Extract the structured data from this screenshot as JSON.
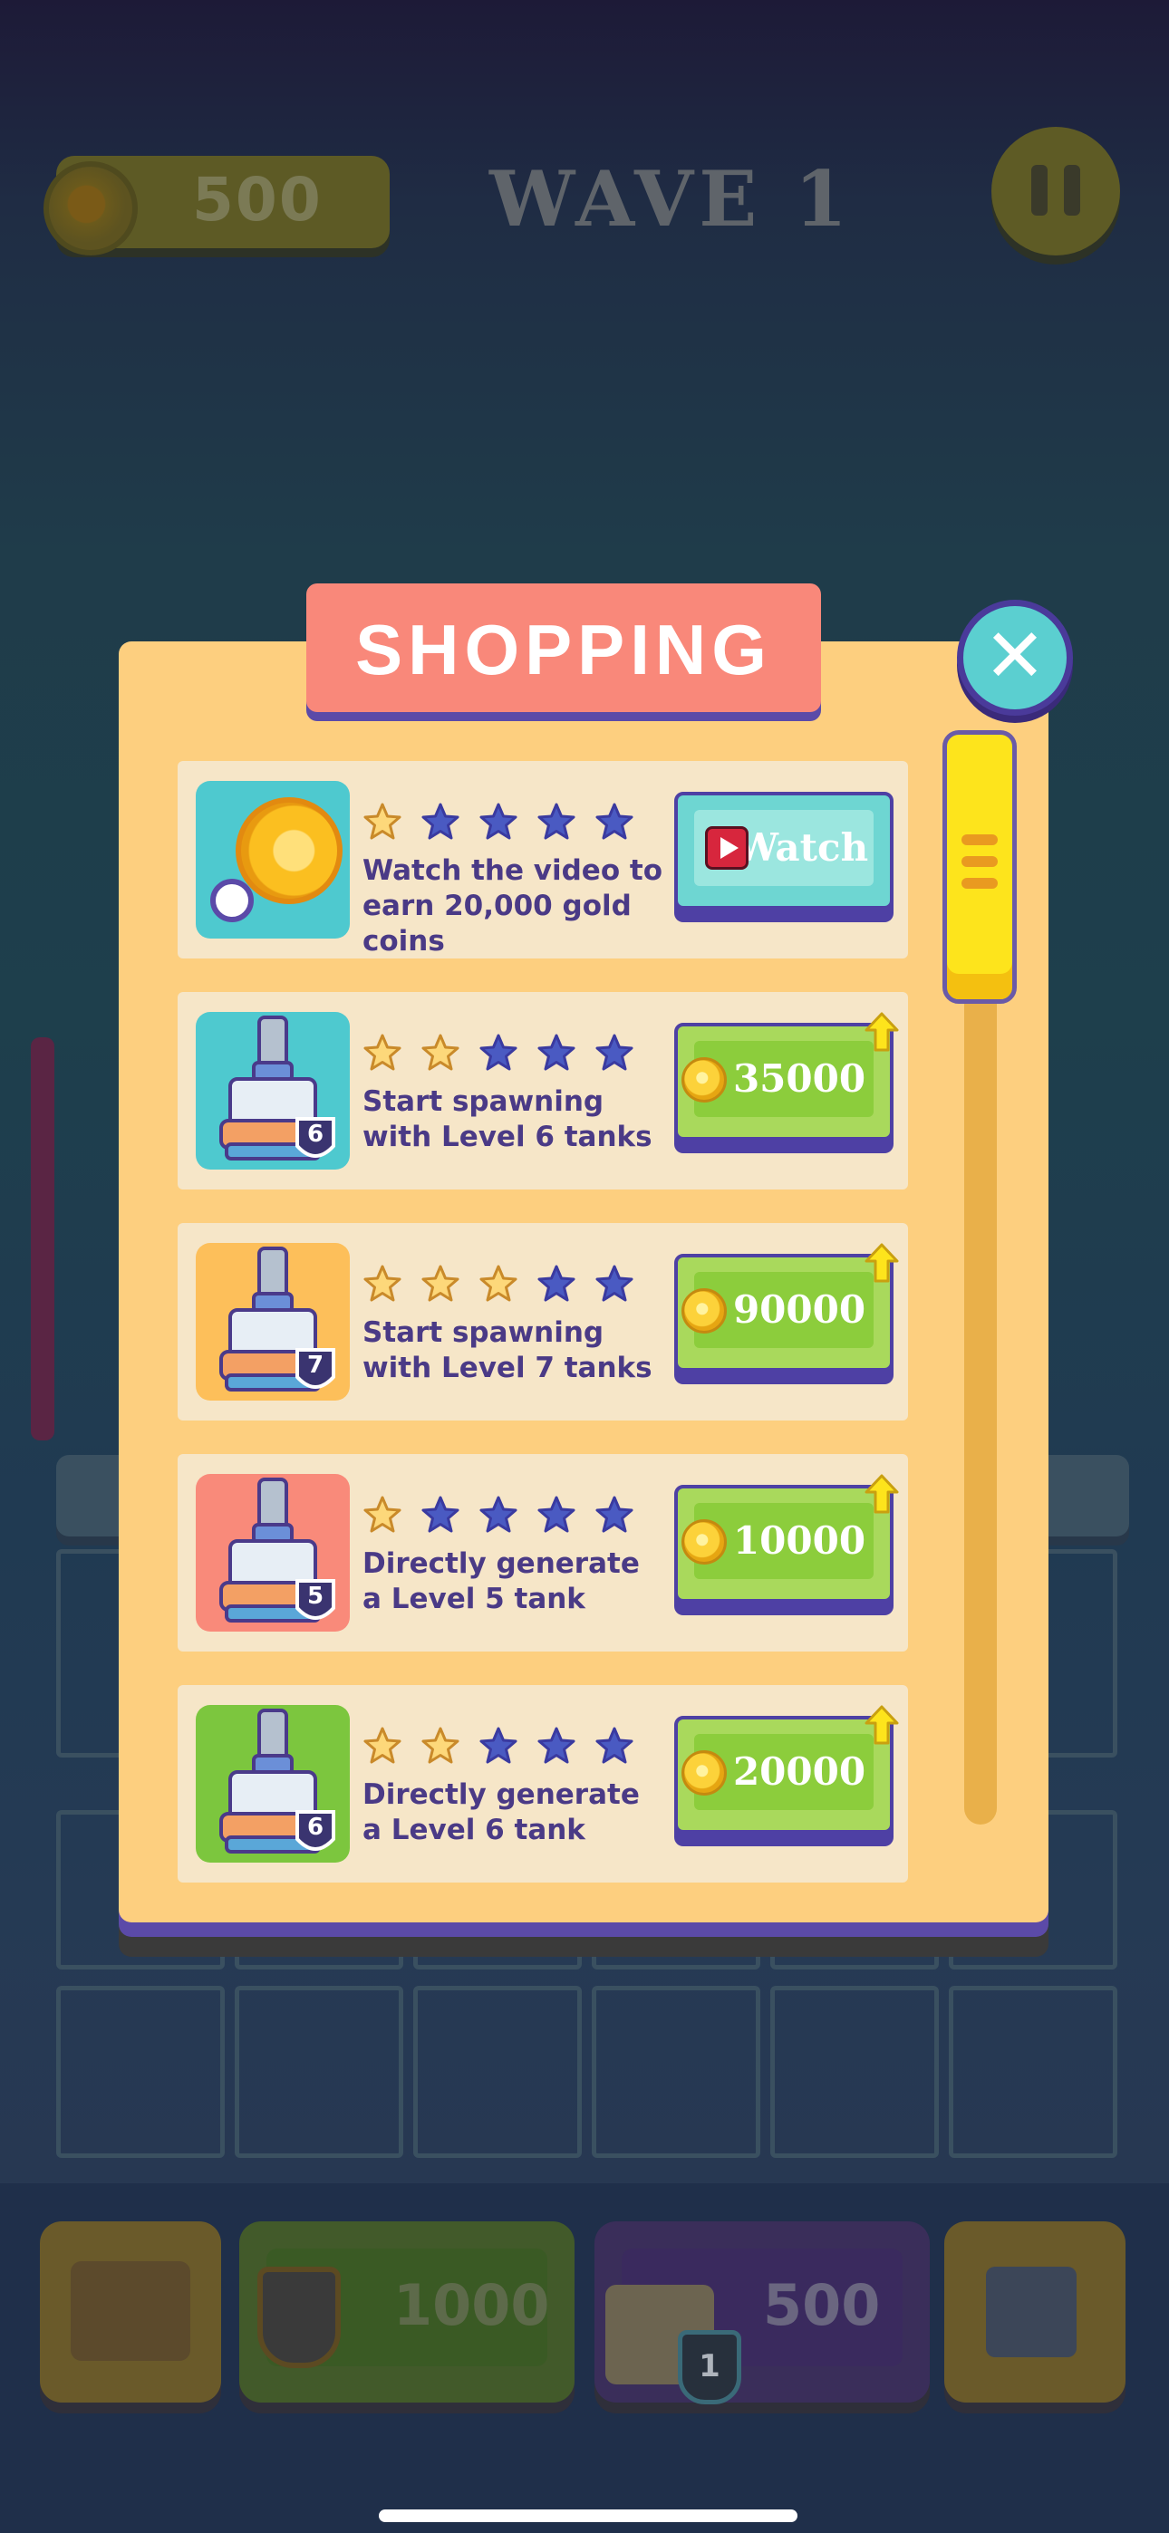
{
  "hud": {
    "coins": "500",
    "wave": "WAVE 1"
  },
  "bottom_bar": {
    "buy_price": "1000",
    "tank_price": "500",
    "tank_level": "1"
  },
  "shop": {
    "title": "SHOPPING",
    "close_label": "✕",
    "items": [
      {
        "desc": "Watch the video to earn 20,000 gold coins",
        "stars": 1,
        "button": "Watch",
        "button_type": "watch",
        "thumb_color": "#4ec9cf",
        "level": ""
      },
      {
        "desc": "Start spawning with Level 6 tanks",
        "stars": 2,
        "button": "35000",
        "button_type": "coin",
        "thumb_color": "#4ec9cf",
        "level": "6"
      },
      {
        "desc": "Start spawning with Level 7 tanks",
        "stars": 3,
        "button": "90000",
        "button_type": "coin",
        "thumb_color": "#fdbf5a",
        "level": "7"
      },
      {
        "desc": "Directly generate a Level 5 tank",
        "stars": 1,
        "button": "10000",
        "button_type": "coin",
        "thumb_color": "#f98a7a",
        "level": "5"
      },
      {
        "desc": "Directly generate a Level 6 tank",
        "stars": 2,
        "button": "20000",
        "button_type": "coin",
        "thumb_color": "#7cc63e",
        "level": "6"
      }
    ]
  },
  "colors": {
    "star_filled": "#fdd87a",
    "star_empty": "#4a5ac2",
    "coin_button": "#a9d95c",
    "watch_button": "#6ed6d2"
  }
}
